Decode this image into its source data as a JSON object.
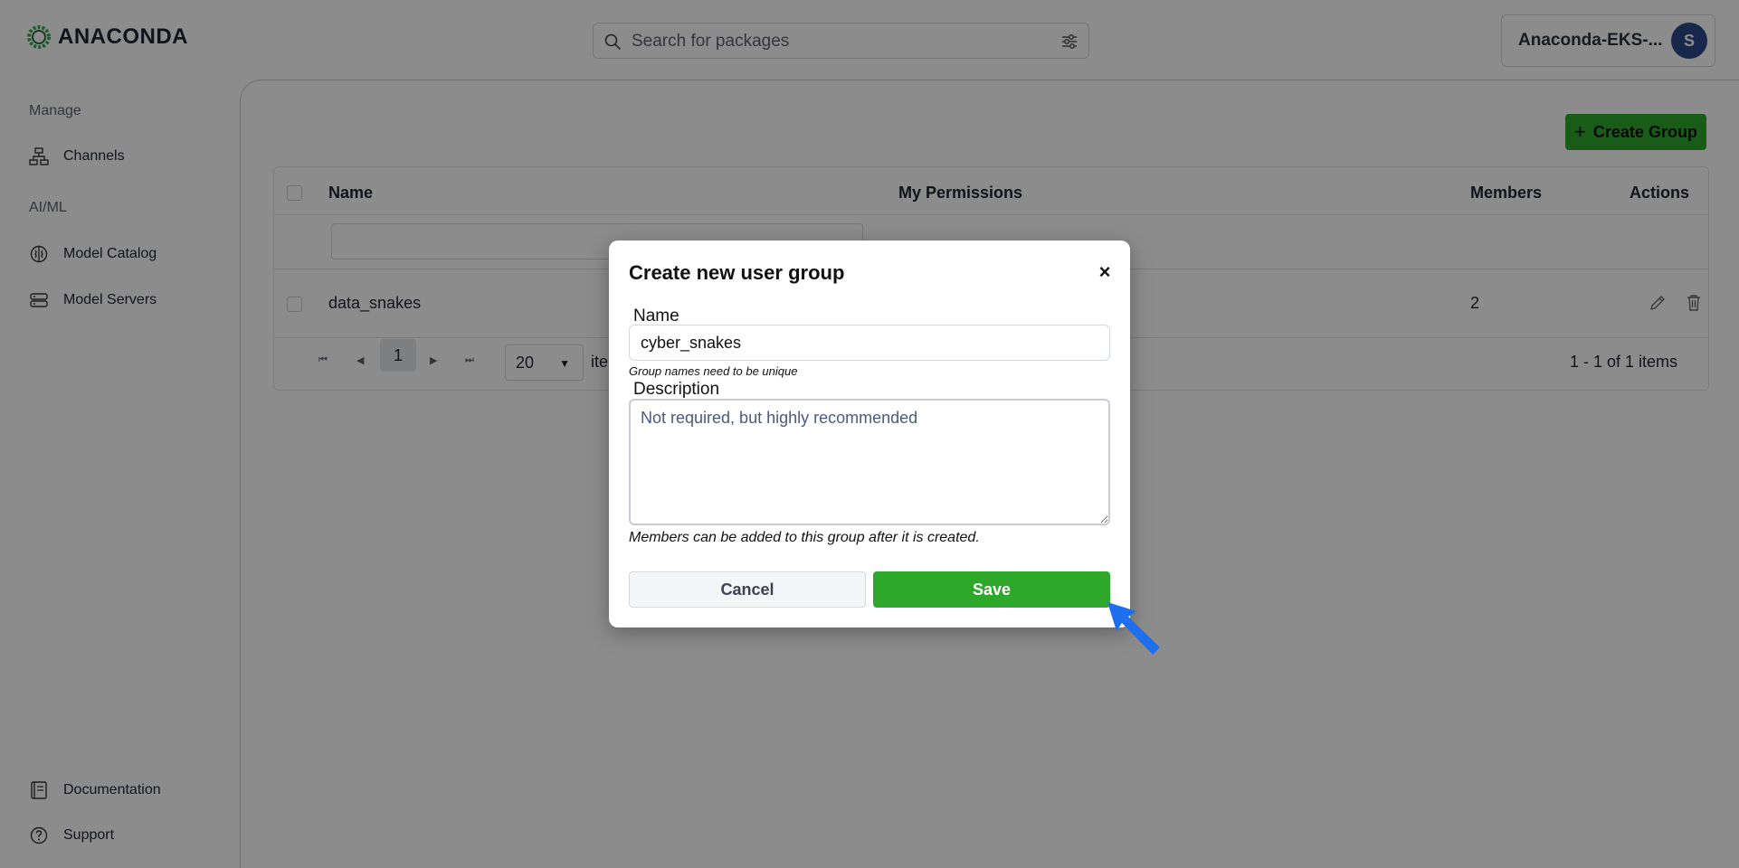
{
  "header": {
    "logo_text": "ANACONDA",
    "search": {
      "placeholder": "Search for packages",
      "value": ""
    },
    "account": {
      "name": "Anaconda-EKS-...",
      "avatar_initial": "S"
    }
  },
  "sidebar": {
    "sections": [
      {
        "title": "Manage",
        "items": [
          {
            "label": "Channels",
            "icon": "channels-icon"
          }
        ]
      },
      {
        "title": "AI/ML",
        "items": [
          {
            "label": "Model Catalog",
            "icon": "brain-icon"
          },
          {
            "label": "Model Servers",
            "icon": "server-icon"
          }
        ]
      }
    ],
    "footer_items": [
      {
        "label": "Documentation",
        "icon": "book-icon"
      },
      {
        "label": "Support",
        "icon": "help-icon"
      }
    ]
  },
  "main": {
    "create_button_label": "Create Group",
    "table": {
      "columns": [
        "Name",
        "My Permissions",
        "Members",
        "Actions"
      ],
      "rows": [
        {
          "name": "data_snakes",
          "permissions": "",
          "members": "2"
        }
      ]
    },
    "pagination": {
      "current_page": "1",
      "page_size": "20",
      "items_label": "ite",
      "summary": "1 - 1 of 1 items"
    }
  },
  "modal": {
    "title": "Create new user group",
    "close_symbol": "×",
    "name_label": "Name",
    "name_value": "cyber_snakes",
    "name_hint": "Group names need to be unique",
    "description_label": "Description",
    "description_placeholder": "Not required, but highly recommended",
    "members_note": "Members can be added to this group after it is created.",
    "cancel_label": "Cancel",
    "save_label": "Save"
  },
  "colors": {
    "accent_green": "#2da82a",
    "avatar_blue": "#2c4a8a",
    "pointer_blue": "#1e6ff0"
  }
}
